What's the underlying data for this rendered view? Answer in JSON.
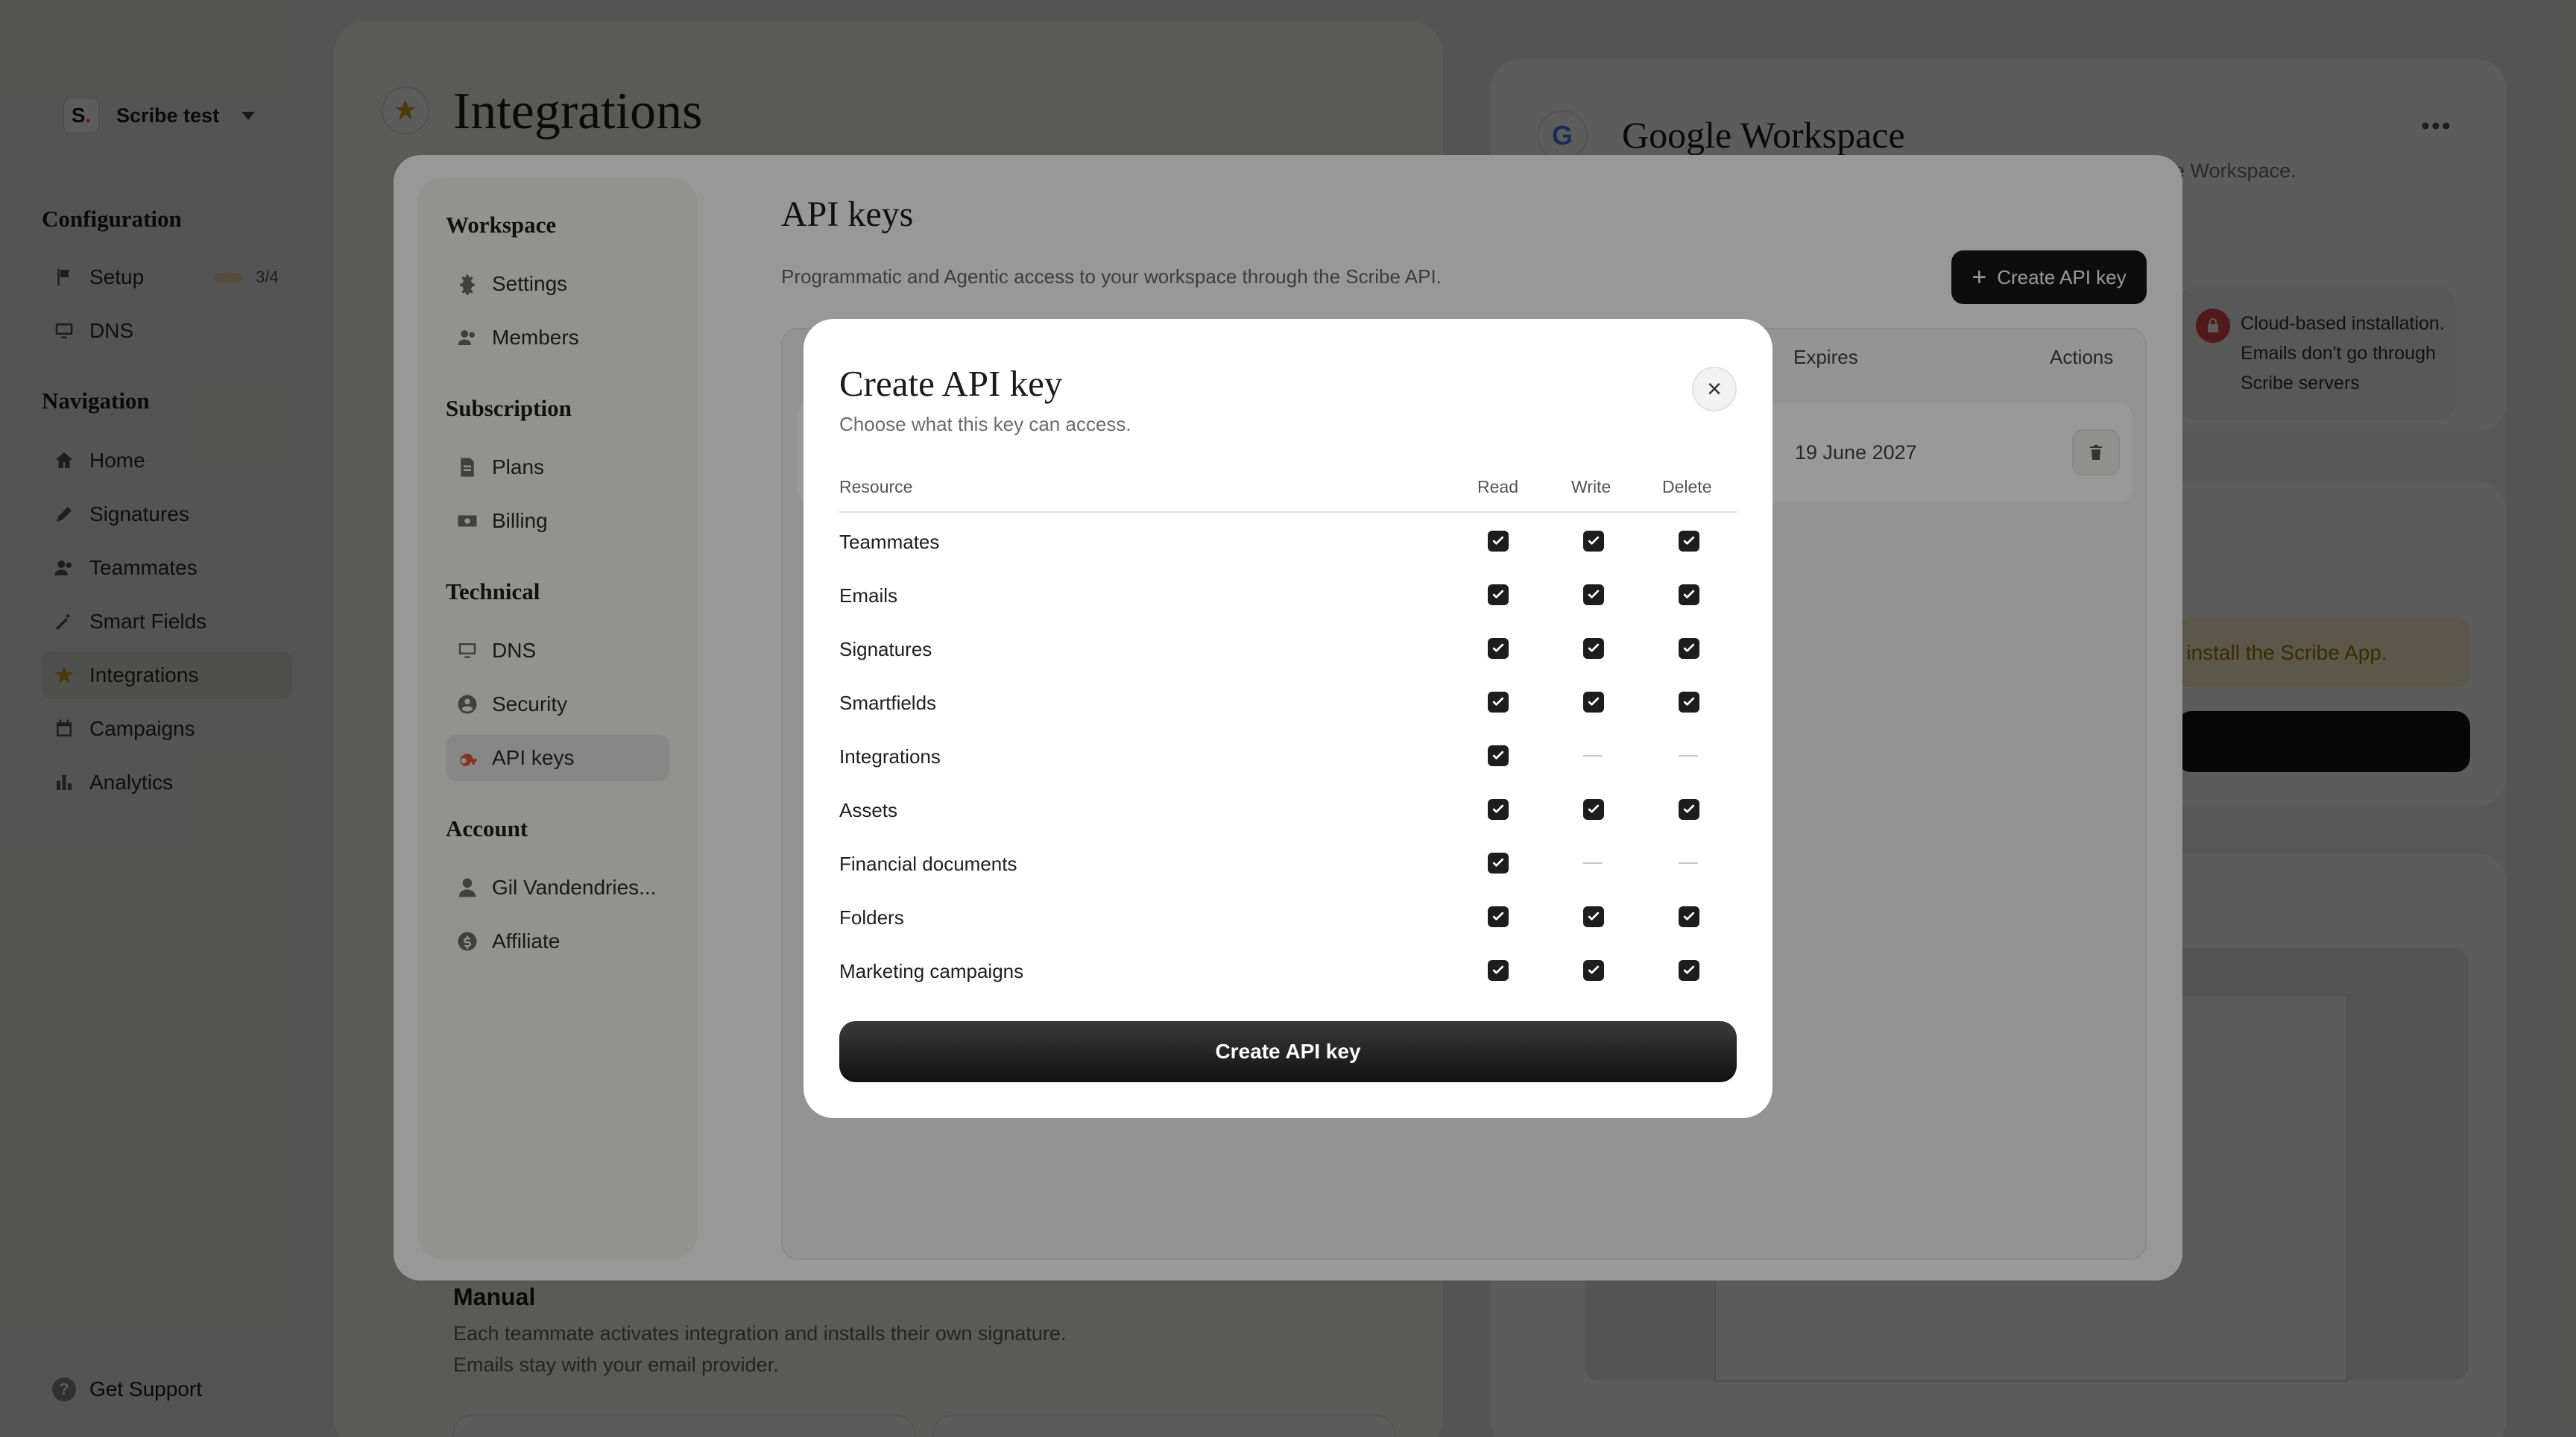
{
  "workspace": {
    "logo_letter": "S",
    "logo_dot": ".",
    "name": "Scribe test"
  },
  "sidebar": {
    "configuration_title": "Configuration",
    "setup_label": "Setup",
    "setup_progress_text": "3/4",
    "setup_progress_fraction": 0.75,
    "dns_label": "DNS",
    "navigation_title": "Navigation",
    "nav_items": [
      {
        "label": "Home",
        "icon": "home-icon"
      },
      {
        "label": "Signatures",
        "icon": "pen-icon"
      },
      {
        "label": "Teammates",
        "icon": "users-icon"
      },
      {
        "label": "Smart Fields",
        "icon": "wand-icon"
      },
      {
        "label": "Integrations",
        "icon": "star-icon",
        "active": true
      },
      {
        "label": "Campaigns",
        "icon": "calendar-icon"
      },
      {
        "label": "Analytics",
        "icon": "bar-chart-icon"
      }
    ],
    "support_label": "Get Support"
  },
  "page": {
    "title": "Integrations",
    "manual_title": "Manual",
    "manual_desc_1": "Each teammate activates integration and installs their own signature.",
    "manual_desc_2": "Emails stay with your email provider."
  },
  "google_panel": {
    "title": "Google Workspace",
    "subtitle_fragment": "ogle Workspace.",
    "note": "Cloud-based installation. Emails don't go through Scribe servers",
    "install_fragment": "o install the Scribe App."
  },
  "settings": {
    "sections": {
      "workspace": "Workspace",
      "subscription": "Subscription",
      "technical": "Technical",
      "account": "Account"
    },
    "items": {
      "settings": "Settings",
      "members": "Members",
      "plans": "Plans",
      "billing": "Billing",
      "dns": "DNS",
      "security": "Security",
      "api_keys": "API keys",
      "user": "Gil Vandendries...",
      "affiliate": "Affiliate"
    },
    "api_keys_title": "API keys",
    "api_keys_desc": "Programmatic and Agentic access to your workspace through the Scribe API.",
    "create_button": "Create API key",
    "table": {
      "col_expires": "Expires",
      "col_actions": "Actions",
      "rows": [
        {
          "expires": "19 June 2027"
        }
      ]
    }
  },
  "dialog": {
    "title": "Create API key",
    "subtitle": "Choose what this key can access.",
    "close_icon": "close-icon",
    "columns": {
      "resource": "Resource",
      "read": "Read",
      "write": "Write",
      "delete": "Delete"
    },
    "rows": [
      {
        "label": "Teammates",
        "read": true,
        "write": true,
        "delete": true
      },
      {
        "label": "Emails",
        "read": true,
        "write": true,
        "delete": true
      },
      {
        "label": "Signatures",
        "read": true,
        "write": true,
        "delete": true
      },
      {
        "label": "Smartfields",
        "read": true,
        "write": true,
        "delete": true
      },
      {
        "label": "Integrations",
        "read": true,
        "write": null,
        "delete": null
      },
      {
        "label": "Assets",
        "read": true,
        "write": true,
        "delete": true
      },
      {
        "label": "Financial documents",
        "read": true,
        "write": null,
        "delete": null
      },
      {
        "label": "Folders",
        "read": true,
        "write": true,
        "delete": true
      },
      {
        "label": "Marketing campaigns",
        "read": true,
        "write": true,
        "delete": true
      }
    ],
    "submit_label": "Create API key"
  }
}
